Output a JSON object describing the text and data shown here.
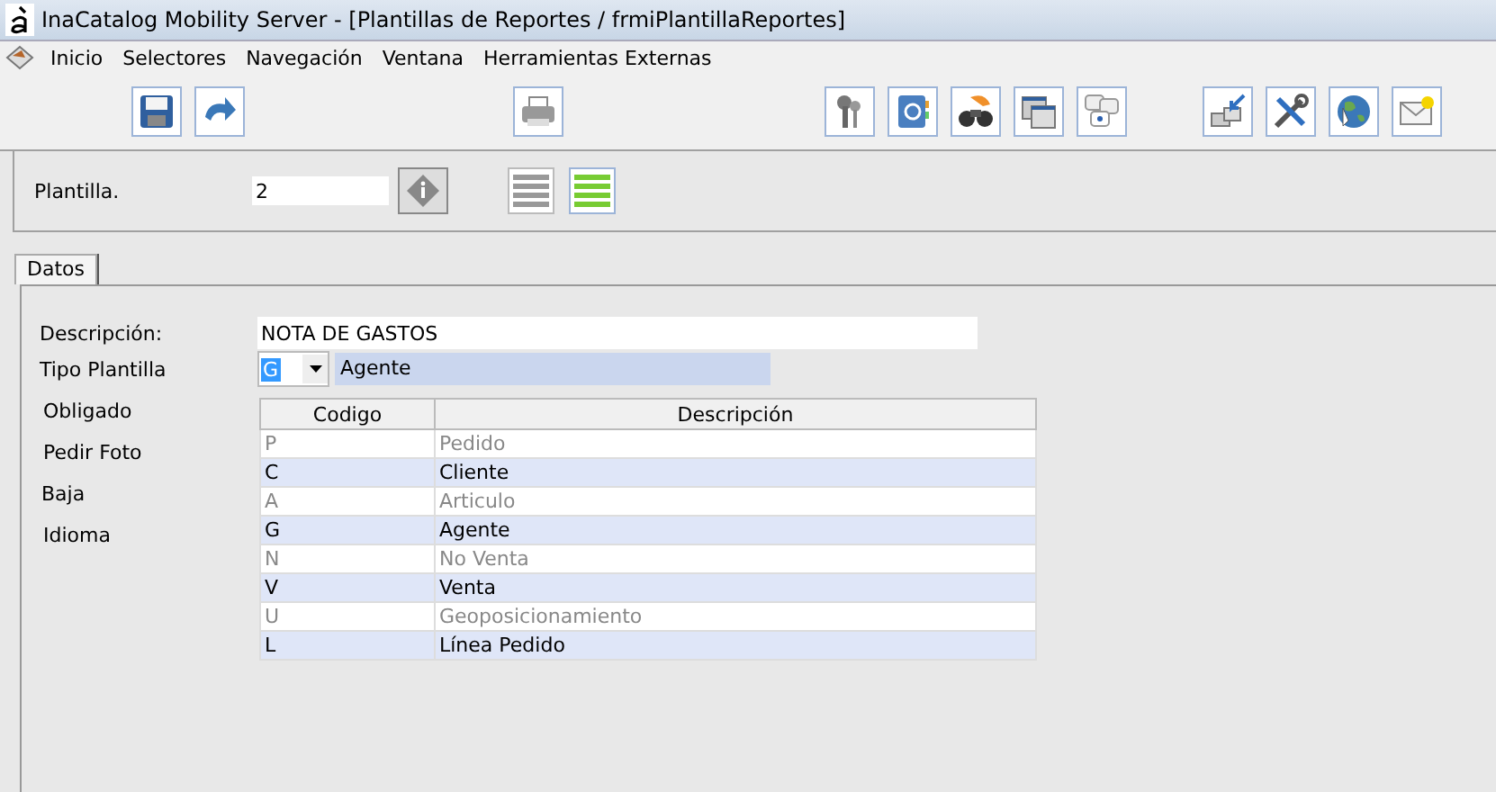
{
  "window": {
    "title": "InaCatalog Mobility Server - [Plantillas de Reportes / frmiPlantillaReportes]"
  },
  "menu": [
    "Inicio",
    "Selectores",
    "Navegación",
    "Ventana",
    "Herramientas Externas"
  ],
  "header": {
    "label": "Plantilla.",
    "value": "2"
  },
  "tabs": [
    {
      "label": "Datos",
      "selected": true
    }
  ],
  "form": {
    "descripcion_label": "Descripción:",
    "descripcion": "NOTA DE GASTOS",
    "tipo_label": "Tipo Plantilla",
    "tipo_code": "G",
    "tipo_name": "Agente",
    "labels": [
      "Obligado",
      "Pedir Foto",
      "Baja",
      "Idioma"
    ]
  },
  "dropdown": {
    "columns": [
      "Codigo",
      "Descripción"
    ],
    "rows": [
      {
        "code": "P",
        "name": "Pedido"
      },
      {
        "code": "C",
        "name": "Cliente"
      },
      {
        "code": "A",
        "name": "Articulo"
      },
      {
        "code": "G",
        "name": "Agente"
      },
      {
        "code": "N",
        "name": "No Venta"
      },
      {
        "code": "V",
        "name": "Venta"
      },
      {
        "code": "U",
        "name": "Geoposicionamiento"
      },
      {
        "code": "L",
        "name": "Línea Pedido"
      }
    ]
  }
}
